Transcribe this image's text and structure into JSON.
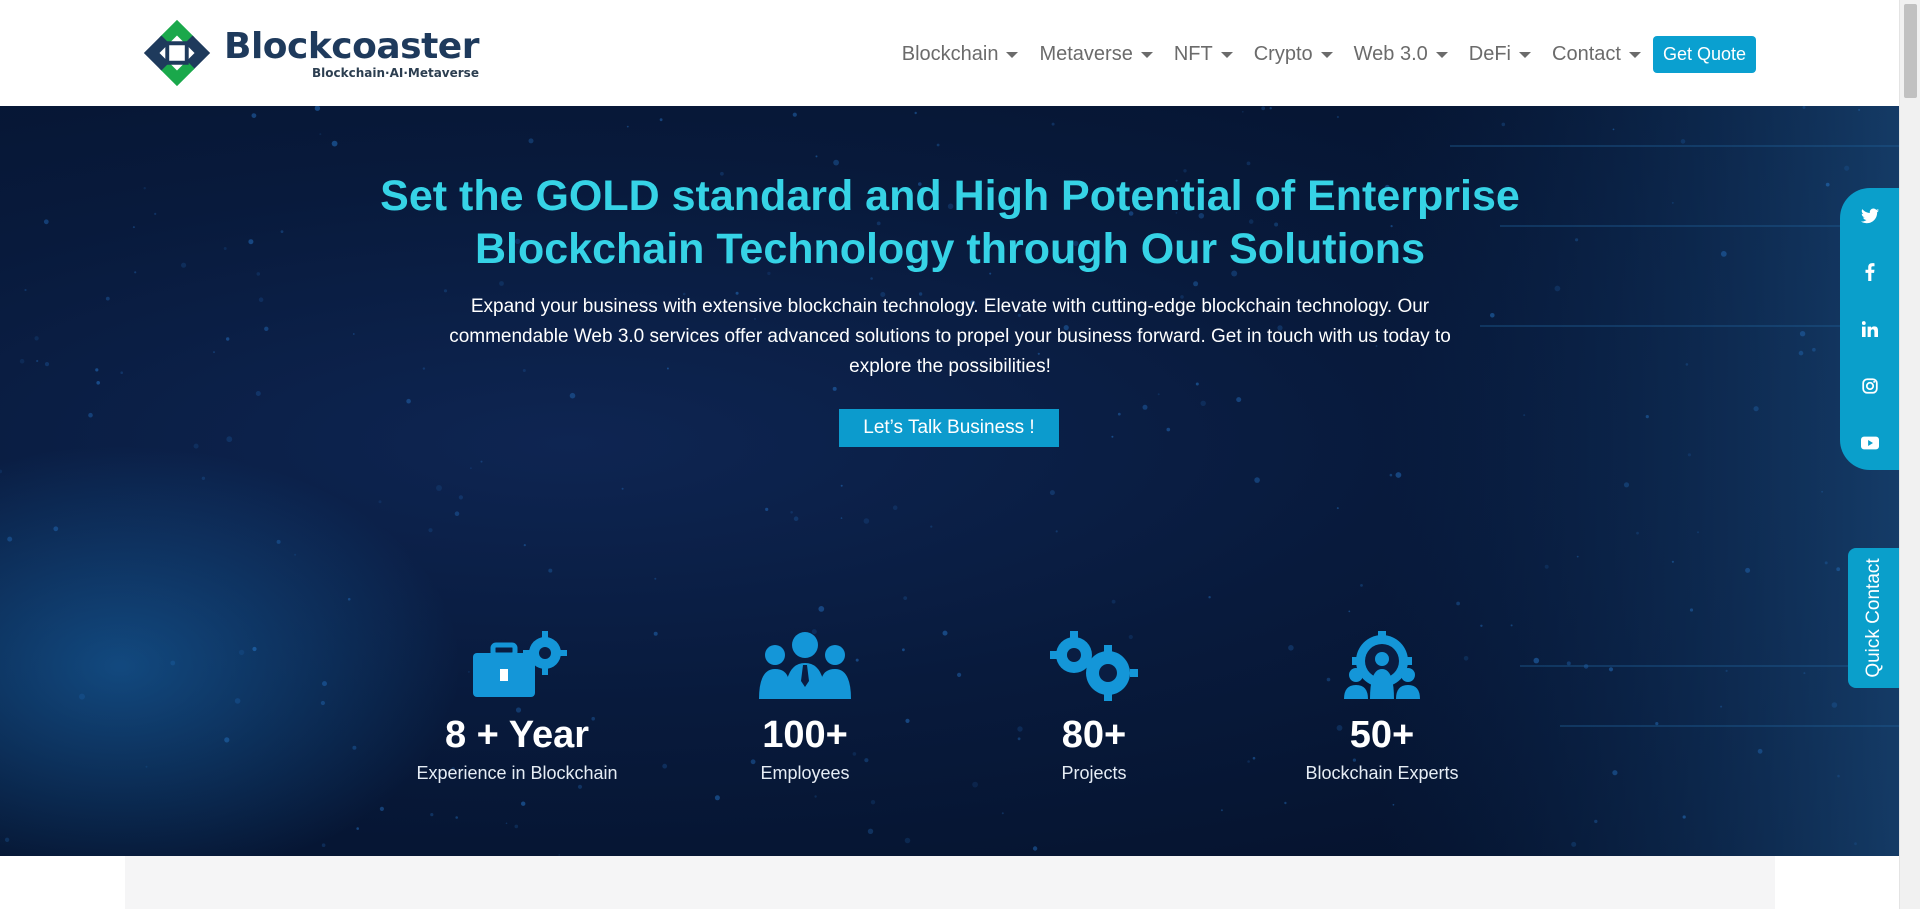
{
  "brand": {
    "name": "Blockcoaster",
    "tagline": "Blockchain·AI·Metaverse",
    "colors": {
      "navy": "#1e3a5c",
      "green": "#1aa84b",
      "accent": "#0aa0d0",
      "title_cyan": "#36d3e6"
    }
  },
  "nav": {
    "items": [
      {
        "label": "Blockchain"
      },
      {
        "label": "Metaverse"
      },
      {
        "label": "NFT"
      },
      {
        "label": "Crypto"
      },
      {
        "label": "Web 3.0"
      },
      {
        "label": "DeFi"
      },
      {
        "label": "Contact"
      }
    ],
    "quote_label": "Get Quote"
  },
  "hero": {
    "title_line1": "Set the GOLD standard and High Potential of Enterprise",
    "title_line2": "Blockchain Technology through Our Solutions",
    "text_line1": "Expand your business with extensive blockchain technology. Elevate with cutting-edge blockchain technology. Our",
    "text_line2": "commendable Web 3.0 services offer advanced solutions to propel your business forward. Get in touch with us today to",
    "text_line3": "explore the possibilities!",
    "cta_label": "Let’s Talk Business !"
  },
  "stats": [
    {
      "value": "8 + Year",
      "label": "Experience in Blockchain",
      "icon": "briefcase-gear-icon"
    },
    {
      "value": "100+",
      "label": "Employees",
      "icon": "team-icon"
    },
    {
      "value": "80+",
      "label": "Projects",
      "icon": "gears-icon"
    },
    {
      "value": "50+",
      "label": "Blockchain Experts",
      "icon": "experts-gear-icon"
    }
  ],
  "social": [
    "twitter-icon",
    "facebook-icon",
    "linkedin-icon",
    "instagram-icon",
    "youtube-icon"
  ],
  "quick_contact": "Quick Contact"
}
